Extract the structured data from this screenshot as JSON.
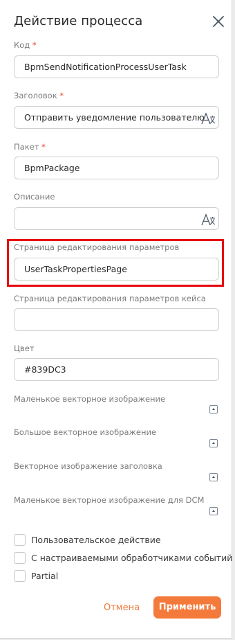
{
  "dialog": {
    "title": "Действие процесса"
  },
  "fields": {
    "code": {
      "label": "Код",
      "required": "*",
      "value": "BpmSendNotificationProcessUserTask"
    },
    "caption": {
      "label": "Заголовок",
      "required": "*",
      "value": "Отправить уведомление пользователю"
    },
    "package": {
      "label": "Пакет",
      "required": "*",
      "value": "BpmPackage"
    },
    "description": {
      "label": "Описание",
      "value": ""
    },
    "edit_page": {
      "label": "Страница редактирования параметров",
      "value": "UserTaskPropertiesPage"
    },
    "case_edit_page": {
      "label": "Страница редактирования параметров кейса",
      "value": ""
    },
    "color": {
      "label": "Цвет",
      "value": "#839DC3"
    }
  },
  "images": [
    {
      "label": "Маленькое векторное изображение",
      "icon": "upload-icon"
    },
    {
      "label": "Большое векторное изображение",
      "icon": "upload-icon"
    },
    {
      "label": "Векторное изображение заголовка",
      "icon": "upload-icon"
    },
    {
      "label": "Маленькое векторное изображение для DCM",
      "icon": "upload-icon"
    }
  ],
  "checkboxes": [
    {
      "label": "Пользовательское действие",
      "checked": false
    },
    {
      "label": "С настраиваемыми обработчиками событий",
      "checked": false
    },
    {
      "label": "Partial",
      "checked": false
    }
  ],
  "actions": {
    "cancel": "Отмена",
    "apply": "Применить"
  },
  "colors": {
    "accent": "#f47a3b",
    "required": "#e8412a",
    "highlight": "#e8000b"
  }
}
